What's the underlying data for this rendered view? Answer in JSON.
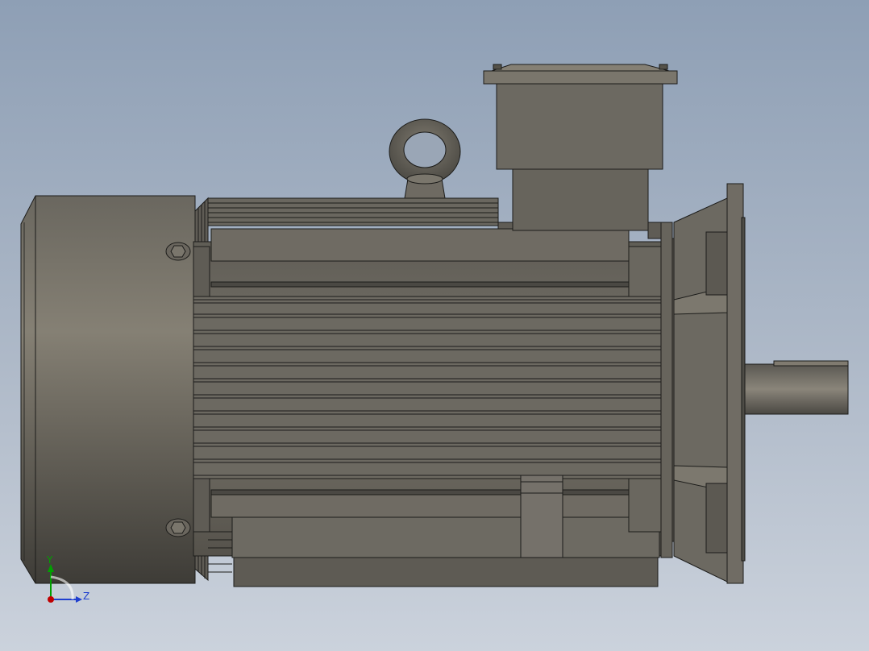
{
  "viewport": {
    "model": "electric-motor",
    "view": "right-side"
  },
  "triad": {
    "y_label": "Y",
    "z_label": "Z",
    "colors": {
      "x": "#c00000",
      "y": "#00a000",
      "z": "#1f3fcf"
    }
  },
  "colors": {
    "background_top": "#8e9fb5",
    "background_bottom": "#cbd2dc",
    "model_body": "#6e6a62",
    "model_edge": "#1c1c1a"
  }
}
